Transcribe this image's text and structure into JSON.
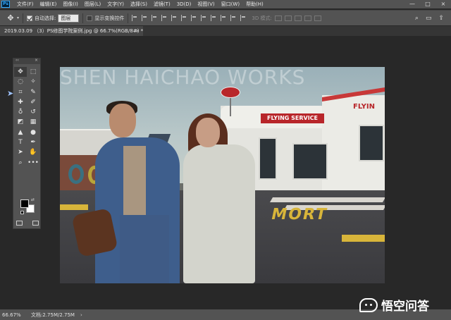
{
  "menu": {
    "logo": "Ps",
    "items": [
      "文件(F)",
      "编辑(E)",
      "图像(I)",
      "图层(L)",
      "文字(Y)",
      "选择(S)",
      "滤镜(T)",
      "3D(D)",
      "视图(V)",
      "窗口(W)",
      "帮助(H)"
    ],
    "window_controls": [
      "—",
      "□",
      "×"
    ]
  },
  "options": {
    "auto_select_label": "自动选择:",
    "auto_select_value": "图层",
    "show_transform_label": "显示变换控件",
    "mode_3d_label": "3D 模式:"
  },
  "document_tab": {
    "title": "2019.03.09 （3）PS修图学院案例.jpg @ 66.7%(RGB/8#) *",
    "close": "×"
  },
  "tools": {
    "items": [
      {
        "name": "move-tool",
        "glyph": "✥"
      },
      {
        "name": "marquee-tool",
        "glyph": "⬚"
      },
      {
        "name": "lasso-tool",
        "glyph": "◌"
      },
      {
        "name": "magic-wand-tool",
        "glyph": "✧"
      },
      {
        "name": "crop-tool",
        "glyph": "⌗"
      },
      {
        "name": "eyedropper-tool",
        "glyph": "✎"
      },
      {
        "name": "healing-tool",
        "glyph": "✚"
      },
      {
        "name": "brush-tool",
        "glyph": "✐"
      },
      {
        "name": "stamp-tool",
        "glyph": "♁"
      },
      {
        "name": "history-brush-tool",
        "glyph": "↺"
      },
      {
        "name": "eraser-tool",
        "glyph": "◩"
      },
      {
        "name": "gradient-tool",
        "glyph": "▦"
      },
      {
        "name": "blur-tool",
        "glyph": "▲"
      },
      {
        "name": "dodge-tool",
        "glyph": "●"
      },
      {
        "name": "type-tool",
        "glyph": "T"
      },
      {
        "name": "pen-tool",
        "glyph": "✒"
      },
      {
        "name": "path-select-tool",
        "glyph": "➤"
      },
      {
        "name": "hand-tool",
        "glyph": "✋"
      },
      {
        "name": "zoom-tool",
        "glyph": "⌕"
      },
      {
        "name": "more-tools",
        "glyph": "•••"
      }
    ]
  },
  "photo": {
    "watermark": "SHEN HAICHAO WORKS",
    "sign_main": "FLYING  SERVICE",
    "sign_right": "FLYIN",
    "road_text": "MORT"
  },
  "status": {
    "zoom": "66.67%",
    "doc_info": "文档:2.75M/2.75M",
    "arrow": "›"
  },
  "brand": {
    "text": "悟空问答"
  },
  "colors": {
    "foreground": "#000000",
    "background": "#ffffff",
    "panel": "#535353",
    "canvas": "#282828"
  }
}
